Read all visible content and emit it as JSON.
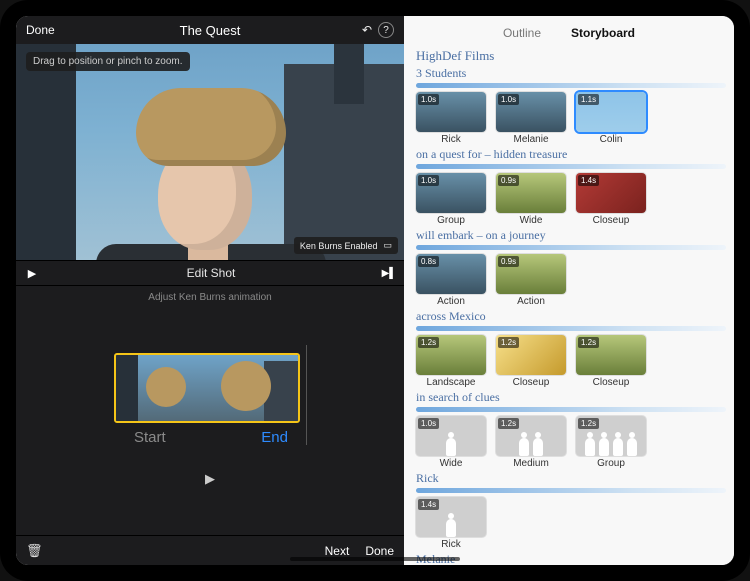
{
  "left": {
    "done": "Done",
    "title": "The Quest",
    "tip": "Drag to position or pinch to zoom.",
    "kenBurns": "Ken Burns Enabled",
    "editShot": "Edit Shot",
    "hint": "Adjust Ken Burns animation",
    "start": "Start",
    "end": "End",
    "next": "Next",
    "doneBottom": "Done"
  },
  "right": {
    "tabOutline": "Outline",
    "tabStoryboard": "Storyboard",
    "heading": "HighDef Films",
    "groups": [
      {
        "title": "3 Students",
        "shots": [
          {
            "dur": "1.0s",
            "label": "Rick",
            "cls": "city",
            "sel": false
          },
          {
            "dur": "1.0s",
            "label": "Melanie",
            "cls": "city",
            "sel": false
          },
          {
            "dur": "1.1s",
            "label": "Colin",
            "cls": "sky",
            "sel": true
          }
        ]
      },
      {
        "title": "on a quest for – hidden treasure",
        "shots": [
          {
            "dur": "1.0s",
            "label": "Group",
            "cls": "city",
            "sel": false
          },
          {
            "dur": "0.9s",
            "label": "Wide",
            "cls": "trees",
            "sel": false
          },
          {
            "dur": "1.4s",
            "label": "Closeup",
            "cls": "red",
            "sel": false
          }
        ]
      },
      {
        "title": "will embark – on a journey",
        "shots": [
          {
            "dur": "0.8s",
            "label": "Action",
            "cls": "city",
            "sel": false
          },
          {
            "dur": "0.9s",
            "label": "Action",
            "cls": "trees",
            "sel": false
          }
        ]
      },
      {
        "title": "across Mexico",
        "shots": [
          {
            "dur": "1.2s",
            "label": "Landscape",
            "cls": "trees",
            "sel": false
          },
          {
            "dur": "1.2s",
            "label": "Closeup",
            "cls": "leaf",
            "sel": false
          },
          {
            "dur": "1.2s",
            "label": "Closeup",
            "cls": "trees",
            "sel": false
          }
        ]
      },
      {
        "title": "in search of clues",
        "shots": [
          {
            "dur": "1.0s",
            "label": "Wide",
            "cls": "ph",
            "sel": false,
            "people": 1
          },
          {
            "dur": "1.2s",
            "label": "Medium",
            "cls": "ph",
            "sel": false,
            "people": 2
          },
          {
            "dur": "1.2s",
            "label": "Group",
            "cls": "ph",
            "sel": false,
            "people": 4
          }
        ]
      },
      {
        "title": "Rick",
        "shots": [
          {
            "dur": "1.4s",
            "label": "Rick",
            "cls": "ph",
            "sel": false,
            "people": 1
          }
        ]
      },
      {
        "title": "Melanie",
        "shots": []
      }
    ]
  }
}
